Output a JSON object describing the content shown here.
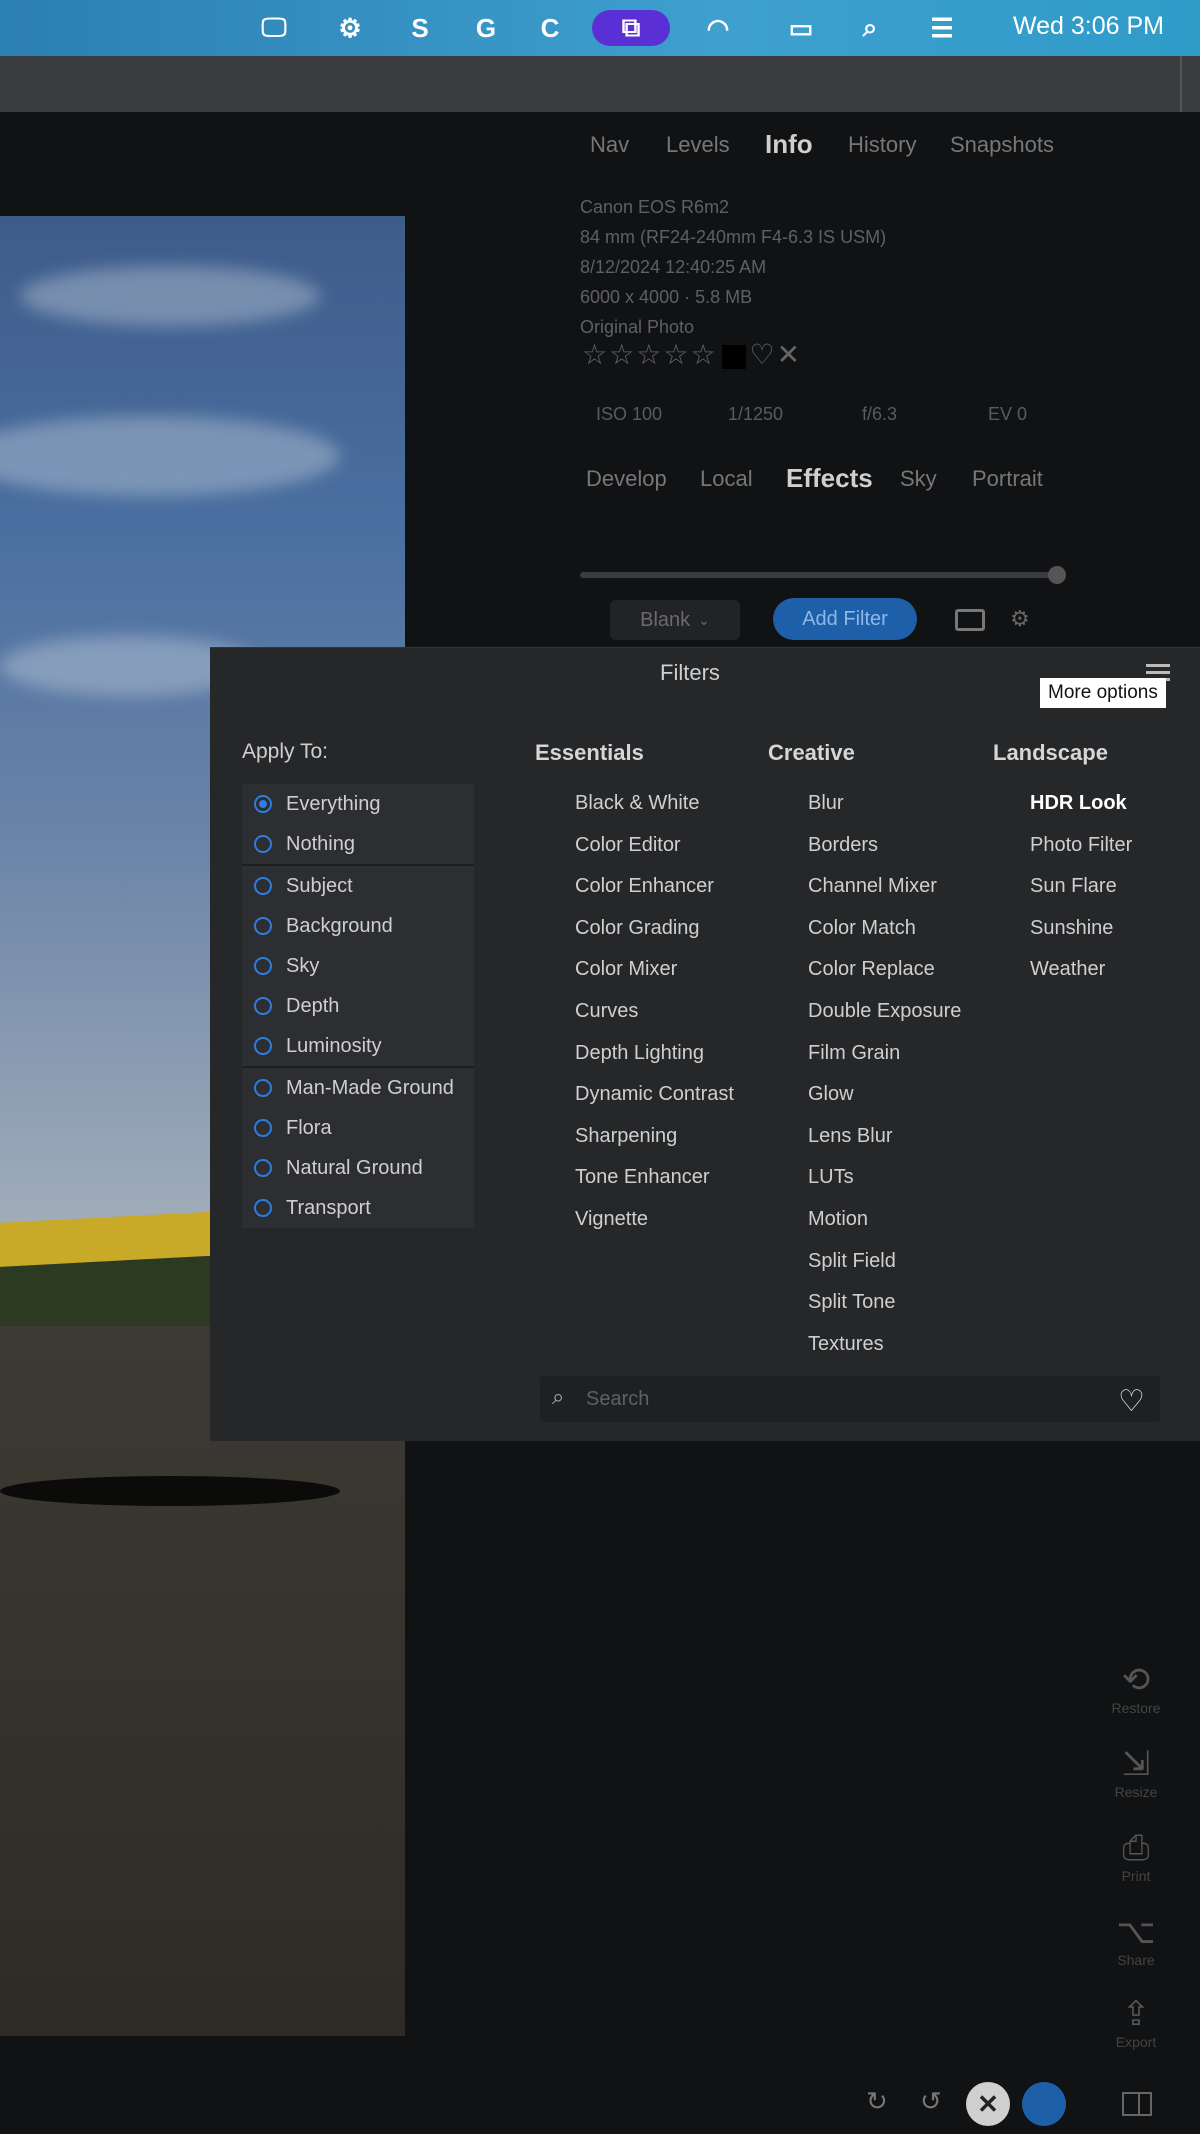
{
  "menubar": {
    "clock": "Wed 3:06 PM",
    "icons": [
      "monitor-icon",
      "cloud-agent-icon",
      "s-app-icon",
      "grammarly-icon",
      "c-app-icon",
      "screen-share-icon",
      "wifi-icon",
      "battery-icon",
      "search-icon",
      "control-center-icon"
    ]
  },
  "right_panel": {
    "top_tabs": [
      "Nav",
      "Levels",
      "Info",
      "History",
      "Snapshots"
    ],
    "active_top_tab": "Info",
    "info_lines": [
      "Canon EOS R6m2",
      "84 mm (RF24-240mm F4-6.3 IS USM)",
      "8/12/2024 12:40:25 AM",
      "6000 x 4000 · 5.8 MB",
      "Original Photo"
    ],
    "exif": [
      "ISO 100",
      "1/1250",
      "f/6.3",
      "EV 0"
    ],
    "bottom_tabs": [
      "Develop",
      "Local",
      "Effects",
      "Sky",
      "Portrait"
    ],
    "active_bottom_tab": "Effects",
    "blank_label": "Blank",
    "add_filter_label": "Add Filter"
  },
  "dialog": {
    "title": "Filters",
    "tooltip": "More options",
    "apply_to_label": "Apply To:",
    "apply_groups": [
      [
        "Everything",
        "Nothing"
      ],
      [
        "Subject",
        "Background",
        "Sky",
        "Depth",
        "Luminosity"
      ],
      [
        "Man-Made Ground",
        "Flora",
        "Natural Ground",
        "Transport"
      ]
    ],
    "selected_apply": "Everything",
    "essentials": {
      "title": "Essentials",
      "items": [
        "Black & White",
        "Color Editor",
        "Color Enhancer",
        "Color Grading",
        "Color Mixer",
        "Curves",
        "Depth Lighting",
        "Dynamic Contrast",
        "Sharpening",
        "Tone Enhancer",
        "Vignette"
      ]
    },
    "creative": {
      "title": "Creative",
      "items": [
        "Blur",
        "Borders",
        "Channel Mixer",
        "Color Match",
        "Color Replace",
        "Double Exposure",
        "Film Grain",
        "Glow",
        "Lens Blur",
        "LUTs",
        "Motion",
        "Split Field",
        "Split Tone",
        "Textures"
      ]
    },
    "landscape": {
      "title": "Landscape",
      "items": [
        "HDR Look",
        "Photo Filter",
        "Sun Flare",
        "Sunshine",
        "Weather"
      ]
    },
    "landscape_bold": "HDR Look",
    "search_placeholder": "Search"
  },
  "side_tools": [
    "Restore",
    "Resize",
    "Print",
    "Share",
    "Export"
  ]
}
